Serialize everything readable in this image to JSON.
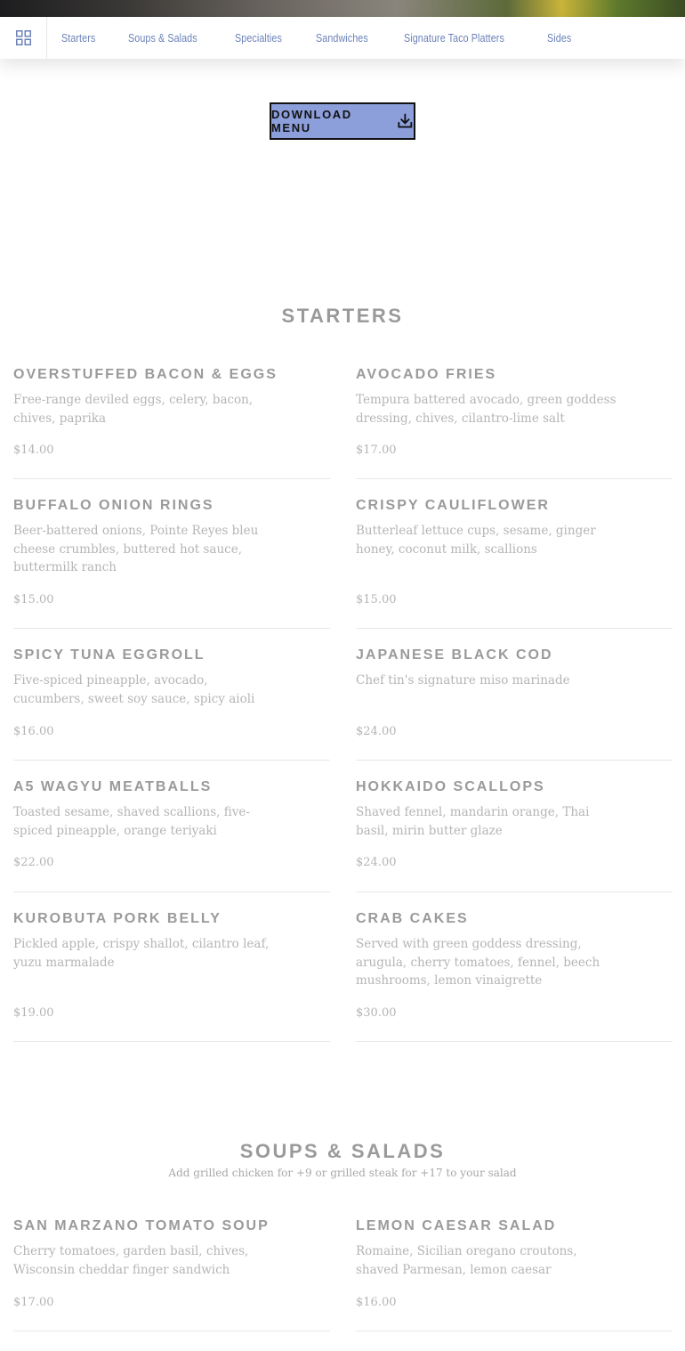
{
  "nav": {
    "links": [
      "Starters",
      "Soups & Salads",
      "Specialties",
      "Sandwiches",
      "Signature Taco Platters",
      "Sides"
    ]
  },
  "download": {
    "label": "DOWNLOAD MENU"
  },
  "starters": {
    "title": "STARTERS",
    "items": [
      {
        "name": "OVERSTUFFED BACON & EGGS",
        "desc": "Free-range deviled eggs, celery, bacon, chives, paprika",
        "price": "$14.00"
      },
      {
        "name": "AVOCADO FRIES",
        "desc": "Tempura battered avocado, green goddess dressing, chives, cilantro-lime salt",
        "price": "$17.00"
      },
      {
        "name": "BUFFALO ONION RINGS",
        "desc": "Beer-battered onions, Pointe Reyes bleu cheese crumbles, buttered hot sauce, buttermilk ranch",
        "price": "$15.00"
      },
      {
        "name": "CRISPY CAULIFLOWER",
        "desc": "Butterleaf lettuce cups, sesame, ginger honey, coconut milk, scallions",
        "price": "$15.00"
      },
      {
        "name": "SPICY TUNA EGGROLL",
        "desc": "Five-spiced pineapple, avocado, cucumbers, sweet soy sauce, spicy aioli",
        "price": "$16.00"
      },
      {
        "name": "JAPANESE BLACK COD",
        "desc": "Chef tin's signature miso marinade",
        "price": "$24.00"
      },
      {
        "name": "A5 WAGYU MEATBALLS",
        "desc": "Toasted sesame, shaved scallions, five-spiced pineapple, orange teriyaki",
        "price": "$22.00"
      },
      {
        "name": "HOKKAIDO SCALLOPS",
        "desc": "Shaved fennel, mandarin orange, Thai basil, mirin butter glaze",
        "price": "$24.00"
      },
      {
        "name": "KUROBUTA PORK BELLY",
        "desc": "Pickled apple, crispy shallot, cilantro leaf, yuzu marmalade",
        "price": "$19.00"
      },
      {
        "name": "CRAB CAKES",
        "desc": "Served with green goddess dressing, arugula, cherry tomatoes, fennel, beech mushrooms, lemon vinaigrette",
        "price": "$30.00"
      }
    ]
  },
  "soups": {
    "title": "SOUPS & SALADS",
    "note": "Add grilled chicken for +9 or grilled steak for +17 to your salad",
    "items": [
      {
        "name": "SAN MARZANO TOMATO SOUP",
        "desc": "Cherry tomatoes, garden basil, chives, Wisconsin cheddar finger sandwich",
        "price": "$17.00"
      },
      {
        "name": "LEMON CAESAR SALAD",
        "desc": "Romaine, Sicilian oregano croutons, shaved Parmesan, lemon caesar",
        "price": "$16.00"
      }
    ]
  }
}
